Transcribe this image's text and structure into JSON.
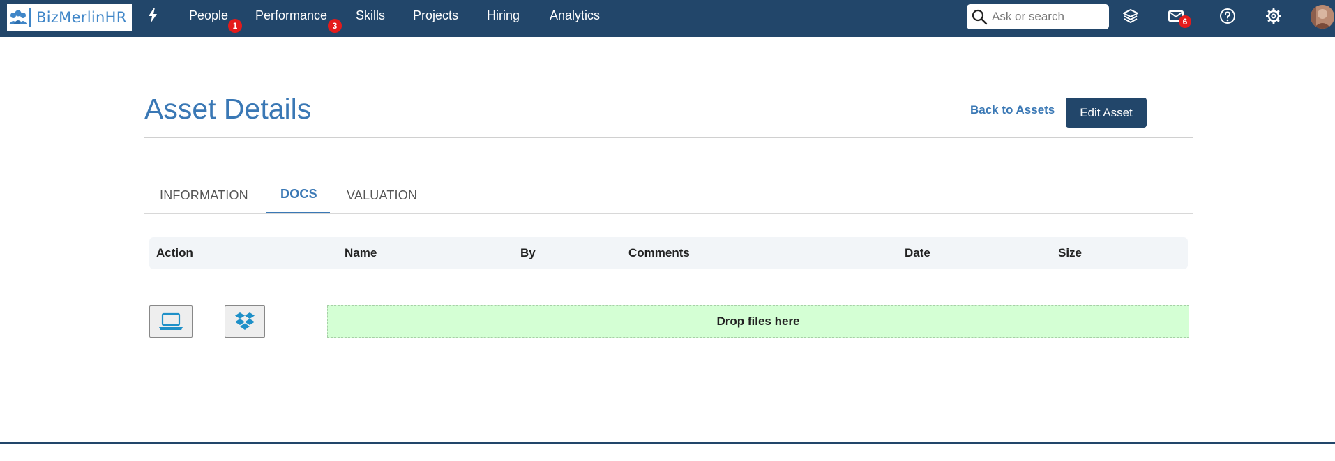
{
  "brand": {
    "name": "BizMerlinHR",
    "prefix": "Biz",
    "suffix": "MerlinHR",
    "accent": "#22466a",
    "link_color": "#3a78b5"
  },
  "nav": {
    "items": [
      {
        "label": "People",
        "badge": "1"
      },
      {
        "label": "Performance",
        "badge": "3"
      },
      {
        "label": "Skills"
      },
      {
        "label": "Projects"
      },
      {
        "label": "Hiring"
      },
      {
        "label": "Analytics"
      }
    ]
  },
  "search": {
    "placeholder": "Ask or search"
  },
  "icons": {
    "quick": "lightning-icon",
    "layers": "layers-icon",
    "mail": "mail-icon",
    "help": "help-icon",
    "settings": "gear-icon"
  },
  "mail_badge": "6",
  "page": {
    "title": "Asset Details",
    "back_link": "Back to Assets",
    "edit_button": "Edit Asset"
  },
  "tabs": [
    {
      "label": "INFORMATION",
      "active": false
    },
    {
      "label": "DOCS",
      "active": true
    },
    {
      "label": "VALUATION",
      "active": false
    }
  ],
  "table": {
    "columns": [
      "Action",
      "Name",
      "By",
      "Comments",
      "Date",
      "Size"
    ]
  },
  "upload": {
    "computer_icon": "laptop-icon",
    "dropbox_icon": "dropbox-icon",
    "dropzone_text": "Drop files here"
  }
}
